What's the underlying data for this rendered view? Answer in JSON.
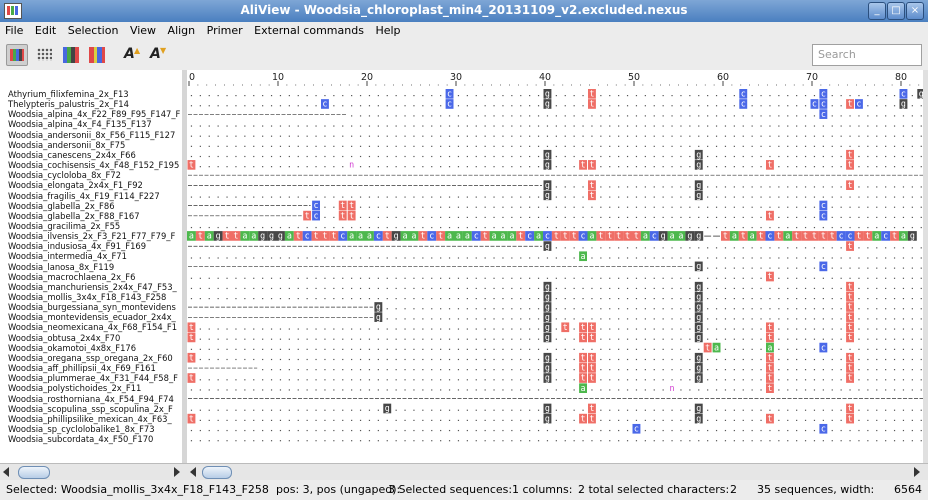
{
  "window": {
    "title": "AliView - Woodsia_chloroplast_min4_20131109_v2.excluded.nexus"
  },
  "menu": [
    "File",
    "Edit",
    "Selection",
    "View",
    "Align",
    "Primer",
    "External commands",
    "Help"
  ],
  "toolbar": {
    "search_placeholder": "Search"
  },
  "ruler": {
    "ticks": [
      0,
      10,
      20,
      30,
      40,
      50,
      60,
      70,
      80
    ]
  },
  "colors": {
    "a": "#4db84d",
    "c": "#4a68e8",
    "g": "#474747",
    "t": "#ef6e66",
    "n": "#d13fd1",
    "gap": "#333333"
  },
  "sequences": [
    {
      "name": "Athyrium_filixfemina_2x_F13",
      "gap": null,
      "bases": "29:c,40:g,45:t,62:c,71:c,80:c,82:g"
    },
    {
      "name": "Thelypteris_palustris_2x_F14",
      "gap": null,
      "bases": "15:c,29:c,40:g,45:t,62:c,70:c,71:c,74:t,75:c,80:g"
    },
    {
      "name": "Woodsia_alpina_4x_F22_F89_F95_F147_F",
      "gap": [
        0,
        18
      ],
      "bases": "71:c"
    },
    {
      "name": "Woodsia_alpina_4x_F4_F135_F137",
      "gap": null,
      "bases": ""
    },
    {
      "name": "Woodsia_andersonii_8x_F56_F115_F127",
      "gap": null,
      "bases": ""
    },
    {
      "name": "Woodsia_andersonii_8x_F75",
      "gap": null,
      "bases": ""
    },
    {
      "name": "Woodsia_canescens_2x4x_F66",
      "gap": null,
      "bases": "40:g,57:g,74:t"
    },
    {
      "name": "Woodsia_cochisensis_4x_F48_F152_F195",
      "gap": null,
      "bases": "0:t,18:n,40:g,44:t,45:t,57:g,65:t,74:t"
    },
    {
      "name": "Woodsia_cycloloba_8x_F72",
      "gap": [
        0,
        83
      ],
      "bases": ""
    },
    {
      "name": "Woodsia_elongata_2x4x_F1_F92",
      "gap": [
        0,
        40
      ],
      "bases": "40:g,45:t,57:g,74:t"
    },
    {
      "name": "Woodsia_fragilis_4x_F19_F114_F227",
      "gap": null,
      "bases": "40:g,45:t,57:g"
    },
    {
      "name": "Woodsia_glabella_2x_F86",
      "gap": [
        0,
        14
      ],
      "bases": "14:c,17:t,18:t,71:c"
    },
    {
      "name": "Woodsia_glabella_2x_F88_F167",
      "gap": [
        0,
        13
      ],
      "bases": "13:t,14:c,17:t,18:t,65:t,71:c"
    },
    {
      "name": "Woodsia_gracilima_2x_F55",
      "gap": null,
      "bases": ""
    },
    {
      "name": "Woodsia_ilvensis_2x_F3_F21_F77_F79_F",
      "gap": null,
      "bases": "FULL"
    },
    {
      "name": "Woodsia_indusiosa_4x_F91_F169",
      "gap": [
        0,
        40
      ],
      "bases": "40:g,74:t"
    },
    {
      "name": "Woodsia_intermedia_4x_F71",
      "gap": null,
      "bases": "44:a"
    },
    {
      "name": "Woodsia_lanosa_8x_F119",
      "gap": [
        0,
        57
      ],
      "bases": "57:g,71:c"
    },
    {
      "name": "Woodsia_macrochlaena_2x_F6",
      "gap": null,
      "bases": "65:t"
    },
    {
      "name": "Woodsia_manchuriensis_2x4x_F47_F53_",
      "gap": null,
      "bases": "40:g,57:g,74:t"
    },
    {
      "name": "Woodsia_mollis_3x4x_F18_F143_F258",
      "gap": null,
      "bases": "40:g,57:g,74:t"
    },
    {
      "name": "Woodsia_burgessiana_syn_montevidens",
      "gap": [
        0,
        21
      ],
      "bases": "21:g,40:g,57:g,74:t"
    },
    {
      "name": "Woodsia_montevidensis_ecuador_2x4x_",
      "gap": [
        0,
        21
      ],
      "bases": "21:g,40:g,57:g,74:t"
    },
    {
      "name": "Woodsia_neomexicana_4x_F68_F154_F1",
      "gap": null,
      "bases": "0:t,40:g,42:t,44:t,45:t,57:g,65:t,74:t"
    },
    {
      "name": "Woodsia_obtusa_2x4x_F70",
      "gap": null,
      "bases": "0:t,40:g,44:t,45:t,57:g,65:t,74:t"
    },
    {
      "name": "Woodsia_okamotoi_4x8x_F176",
      "gap": null,
      "bases": "58:t,59:a,65:a,71:c"
    },
    {
      "name": "Woodsia_oregana_ssp_oregana_2x_F60",
      "gap": null,
      "bases": "0:t,40:g,44:t,45:t,57:g,65:t,74:t"
    },
    {
      "name": "Woodsia_aff_phillipsii_4x_F69_F161",
      "gap": [
        0,
        8
      ],
      "bases": "40:g,44:t,45:t,57:g,65:t,74:t"
    },
    {
      "name": "Woodsia_plummerae_4x_F31_F44_F58_F",
      "gap": null,
      "bases": "0:t,40:g,44:t,45:t,57:g,65:t,74:t"
    },
    {
      "name": "Woodsia_polystichoides_2x_F11",
      "gap": null,
      "bases": "44:a,54:n,65:t"
    },
    {
      "name": "Woodsia_rosthorniana_4x_F54_F94_F74",
      "gap": [
        0,
        83
      ],
      "bases": ""
    },
    {
      "name": "Woodsia_scopulina_ssp_scopulina_2x_F",
      "gap": null,
      "bases": "22:g,40:g,45:t,57:g,74:t"
    },
    {
      "name": "Woodsia_phillipsilike_mexican_4x_F63_",
      "gap": null,
      "bases": "0:t,40:g,44:t,45:t,57:g,65:t,74:t"
    },
    {
      "name": "Woodsia_sp_cyclolobalike1_8x_F73",
      "gap": null,
      "bases": "50:c,71:c"
    },
    {
      "name": "Woodsia_subcordata_4x_F50_F170",
      "gap": null,
      "bases": ""
    }
  ],
  "full_sequence": "atagttaagggatctttcaaactgaatctaaactaaatcactttcatttttacgaagg--tatatctatttttccttactag",
  "status": {
    "selected": "Selected: Woodsia_mollis_3x4x_F18_F143_F258",
    "pos": "pos:   3, pos (ungaped):",
    "selected_sequences": "3 Selected sequences:",
    "columns": "1 columns:",
    "total_chars": "2 total selected characters:",
    "count": "2",
    "summary": "35 sequences, width:",
    "width": "6564"
  }
}
